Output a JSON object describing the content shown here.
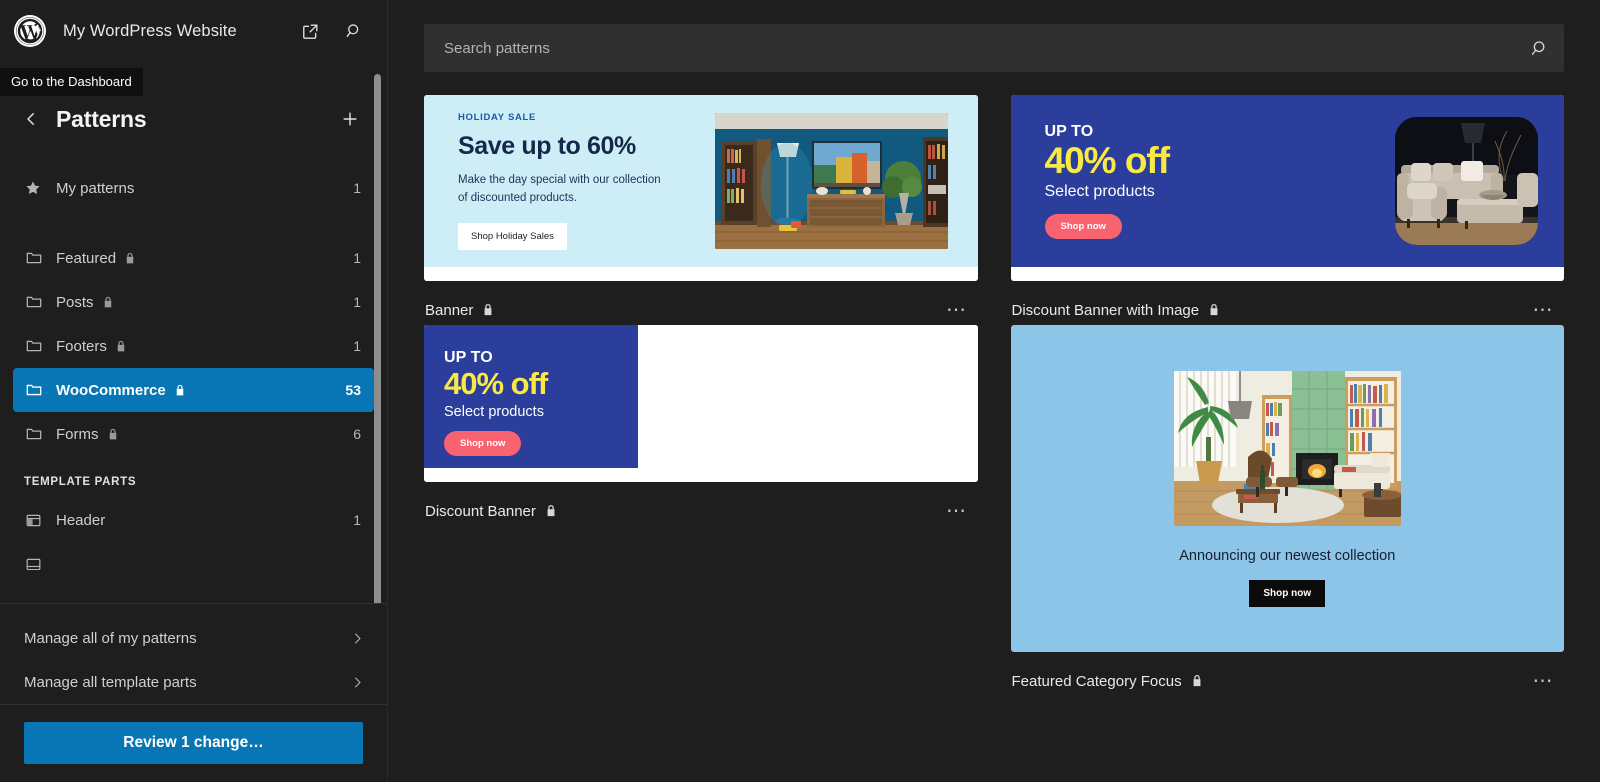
{
  "app": {
    "site_title": "My WordPress Website",
    "logo_icon": "wordpress-logo",
    "view_site_icon": "external-link-icon",
    "search_icon": "search-icon",
    "tooltip": "Go to the Dashboard"
  },
  "sidebar": {
    "back_icon": "chevron-left-icon",
    "panel_title": "Patterns",
    "add_icon": "plus-icon",
    "add_label": "+",
    "nav": [
      {
        "label": "My patterns",
        "count": "1",
        "icon": "star-icon",
        "locked": false,
        "selected": false
      },
      {
        "label": "Featured",
        "count": "1",
        "icon": "folder-icon",
        "locked": true,
        "selected": false
      },
      {
        "label": "Posts",
        "count": "1",
        "icon": "folder-icon",
        "locked": true,
        "selected": false
      },
      {
        "label": "Footers",
        "count": "1",
        "icon": "folder-icon",
        "locked": true,
        "selected": false
      },
      {
        "label": "WooCommerce",
        "count": "53",
        "icon": "folder-icon",
        "locked": true,
        "selected": true
      },
      {
        "label": "Forms",
        "count": "6",
        "icon": "folder-icon",
        "locked": true,
        "selected": false
      }
    ],
    "template_parts_heading": "TEMPLATE PARTS",
    "template_parts": [
      {
        "label": "Header",
        "count": "1",
        "icon": "layout-header-icon"
      }
    ],
    "manage_patterns": "Manage all of my patterns",
    "manage_template_parts": "Manage all template parts",
    "chevron_icon": "chevron-right-icon",
    "save_label": "Review 1 change…",
    "accent_color": "#0875b5"
  },
  "search": {
    "placeholder": "Search patterns",
    "value": "",
    "icon": "search-icon"
  },
  "patterns": [
    {
      "title": "Banner",
      "locked": true,
      "menu_label": "⋯",
      "preview": {
        "kind": "holiday-sale",
        "bg": "#cdeef7",
        "kicker": "HOLIDAY SALE",
        "heading": "Save up to 60%",
        "body": "Make the day special with our collection of discounted products.",
        "button": "Shop Holiday Sales"
      }
    },
    {
      "title": "Discount Banner with Image",
      "locked": true,
      "menu_label": "⋯",
      "preview": {
        "kind": "discount-with-image",
        "bg": "#2b3e9b",
        "upto": "UP TO",
        "percent": "40% off",
        "subtitle": "Select products",
        "button": "Shop now",
        "accent": "#f9e945",
        "button_bg": "#f9636f"
      }
    },
    {
      "title": "Discount Banner",
      "locked": true,
      "menu_label": "⋯",
      "preview": {
        "kind": "discount-half",
        "bg": "#2b3e9b",
        "upto": "UP TO",
        "percent": "40% off",
        "subtitle": "Select products",
        "button": "Shop now",
        "accent": "#f9e945",
        "button_bg": "#f9636f"
      }
    },
    {
      "title": "Featured Category Focus",
      "locked": true,
      "menu_label": "⋯",
      "preview": {
        "kind": "featured-category",
        "bg": "#8dc5e8",
        "caption": "Announcing our newest collection",
        "button": "Shop now"
      }
    }
  ]
}
